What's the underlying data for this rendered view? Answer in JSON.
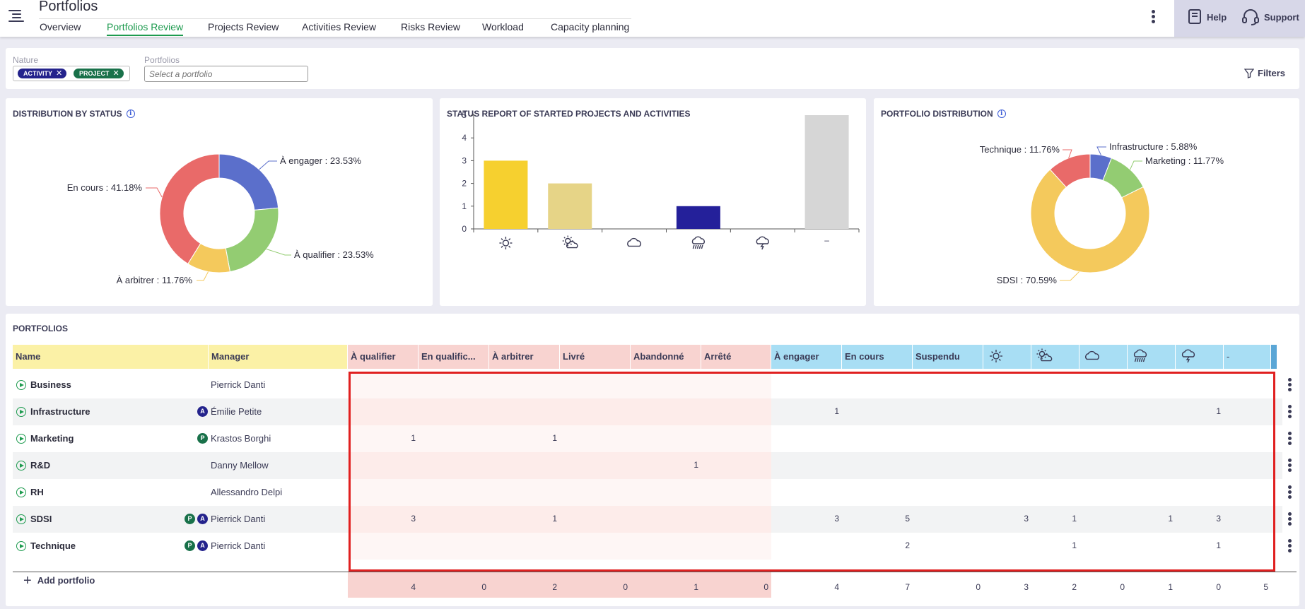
{
  "header": {
    "title": "Portfolios",
    "tabs": [
      "Overview",
      "Portfolios Review",
      "Projects Review",
      "Activities Review",
      "Risks Review",
      "Workload",
      "Capacity planning"
    ],
    "active_tab": "Portfolios Review",
    "help_label": "Help",
    "support_label": "Support"
  },
  "filters": {
    "nature_label": "Nature",
    "chips": [
      {
        "label": "ACTIVITY",
        "color": "#24238c"
      },
      {
        "label": "PROJECT",
        "color": "#19714a"
      }
    ],
    "portfolios_label": "Portfolios",
    "portfolios_placeholder": "Select a portfolio",
    "filters_button": "Filters"
  },
  "chart_data": [
    {
      "type": "pie",
      "title": "DISTRIBUTION BY STATUS",
      "slices": [
        {
          "label": "À engager : 23.53%",
          "value": 23.53,
          "color": "#5b6fcb"
        },
        {
          "label": "À qualifier : 23.53%",
          "value": 23.53,
          "color": "#93cc72"
        },
        {
          "label": "À arbitrer : 11.76%",
          "value": 11.76,
          "color": "#f4c95c"
        },
        {
          "label": "En cours : 41.18%",
          "value": 41.18,
          "color": "#e96a69"
        }
      ]
    },
    {
      "type": "bar",
      "title": "STATUS REPORT OF STARTED PROJECTS AND ACTIVITIES",
      "categories": [
        "sunny",
        "partly-cloudy",
        "cloudy",
        "rainy",
        "stormy",
        "–"
      ],
      "values": [
        3,
        2,
        0,
        1,
        0,
        5
      ],
      "colors": [
        "#f6d02f",
        "#e6d487",
        "#cccccc",
        "#24209a",
        "#999999",
        "#d6d6d6"
      ],
      "ylim": [
        0,
        5
      ],
      "yticks": [
        0,
        1,
        2,
        3,
        4,
        5
      ]
    },
    {
      "type": "pie",
      "title": "PORTFOLIO DISTRIBUTION",
      "slices": [
        {
          "label": "Infrastructure : 5.88%",
          "value": 5.88,
          "color": "#5b6fcb"
        },
        {
          "label": "Marketing : 11.77%",
          "value": 11.77,
          "color": "#93cc72"
        },
        {
          "label": "SDSI : 70.59%",
          "value": 70.59,
          "color": "#f4c95c"
        },
        {
          "label": "Technique : 11.76%",
          "value": 11.76,
          "color": "#e96a69"
        }
      ]
    }
  ],
  "table": {
    "title": "PORTFOLIOS",
    "columns": [
      "Name",
      "Manager",
      "À qualifier",
      "En qualific...",
      "À arbitrer",
      "Livré",
      "Abandonné",
      "Arrêté",
      "À engager",
      "En cours",
      "Suspendu",
      "sunny",
      "partly-cloudy",
      "cloudy",
      "rainy",
      "stormy",
      "-"
    ],
    "rows": [
      {
        "name": "Business",
        "manager": "Pierrick Danti",
        "badges": [],
        "values": [
          "",
          "",
          "",
          "",
          "",
          "",
          "",
          "",
          "",
          "",
          "",
          "",
          "",
          ""
        ]
      },
      {
        "name": "Infrastructure",
        "manager": "Émilie Petite",
        "badges": [
          "A"
        ],
        "values": [
          "",
          "",
          "",
          "",
          "",
          "",
          "1",
          "",
          "",
          "",
          "",
          "",
          "",
          "1"
        ]
      },
      {
        "name": "Marketing",
        "manager": "Krastos Borghi",
        "badges": [
          "P"
        ],
        "values": [
          "1",
          "",
          "1",
          "",
          "",
          "",
          "",
          "",
          "",
          "",
          "",
          "",
          "",
          ""
        ]
      },
      {
        "name": "R&D",
        "manager": "Danny Mellow",
        "badges": [],
        "values": [
          "",
          "",
          "",
          "",
          "1",
          "",
          "",
          "",
          "",
          "",
          "",
          "",
          "",
          ""
        ]
      },
      {
        "name": "RH",
        "manager": "Allessandro Delpi",
        "badges": [],
        "values": [
          "",
          "",
          "",
          "",
          "",
          "",
          "",
          "",
          "",
          "",
          "",
          "",
          "",
          ""
        ]
      },
      {
        "name": "SDSI",
        "manager": "Pierrick Danti",
        "badges": [
          "P",
          "A"
        ],
        "values": [
          "3",
          "",
          "1",
          "",
          "",
          "",
          "3",
          "5",
          "",
          "3",
          "1",
          "",
          "1",
          "3"
        ]
      },
      {
        "name": "Technique",
        "manager": "Pierrick Danti",
        "badges": [
          "P",
          "A"
        ],
        "values": [
          "",
          "",
          "",
          "",
          "",
          "",
          "",
          "2",
          "",
          "",
          "1",
          "",
          "",
          "1"
        ]
      }
    ],
    "totals": [
      "4",
      "0",
      "2",
      "0",
      "1",
      "0",
      "4",
      "7",
      "0",
      "3",
      "2",
      "0",
      "1",
      "0",
      "5"
    ],
    "add_label": "Add portfolio"
  }
}
